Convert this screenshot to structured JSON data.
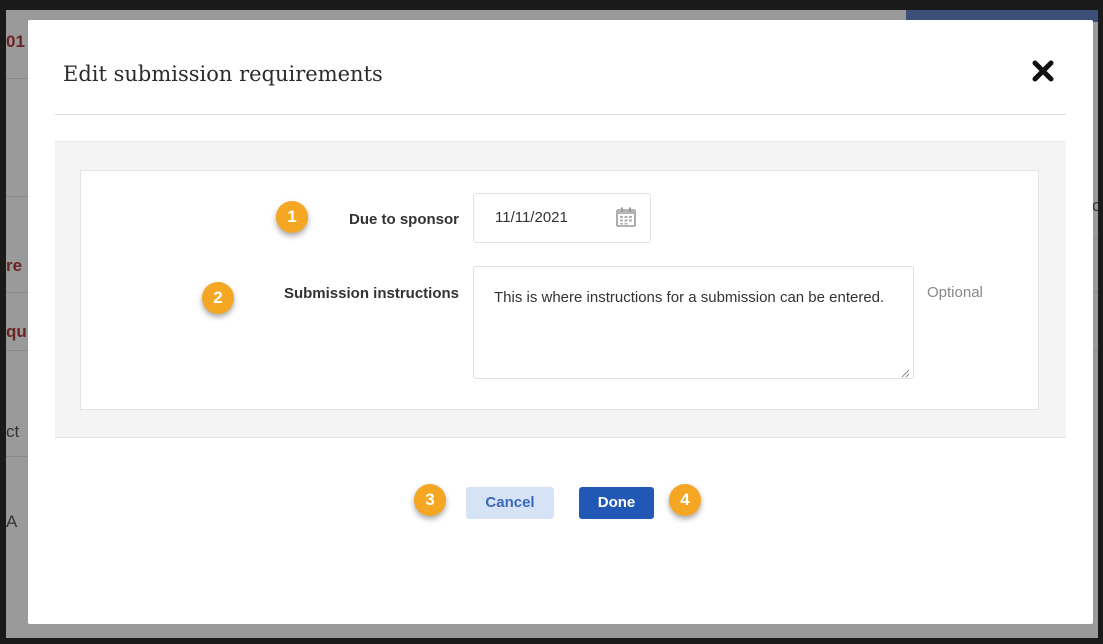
{
  "background": {
    "fragments": [
      "01",
      "re",
      "qu",
      "ct",
      "A",
      "o"
    ]
  },
  "modal": {
    "title": "Edit submission requirements",
    "close_icon": "close-icon"
  },
  "form": {
    "due_to_sponsor": {
      "label": "Due to sponsor",
      "value": "11/11/2021",
      "icon": "calendar-icon"
    },
    "submission_instructions": {
      "label": "Submission instructions",
      "value": "This is where instructions for a submission can be entered.",
      "hint": "Optional"
    }
  },
  "buttons": {
    "cancel_label": "Cancel",
    "done_label": "Done"
  },
  "callouts": [
    "1",
    "2",
    "3",
    "4"
  ],
  "colors": {
    "callout": "#f5a623",
    "primary": "#2158b5",
    "secondary_bg": "#d6e3f7"
  }
}
